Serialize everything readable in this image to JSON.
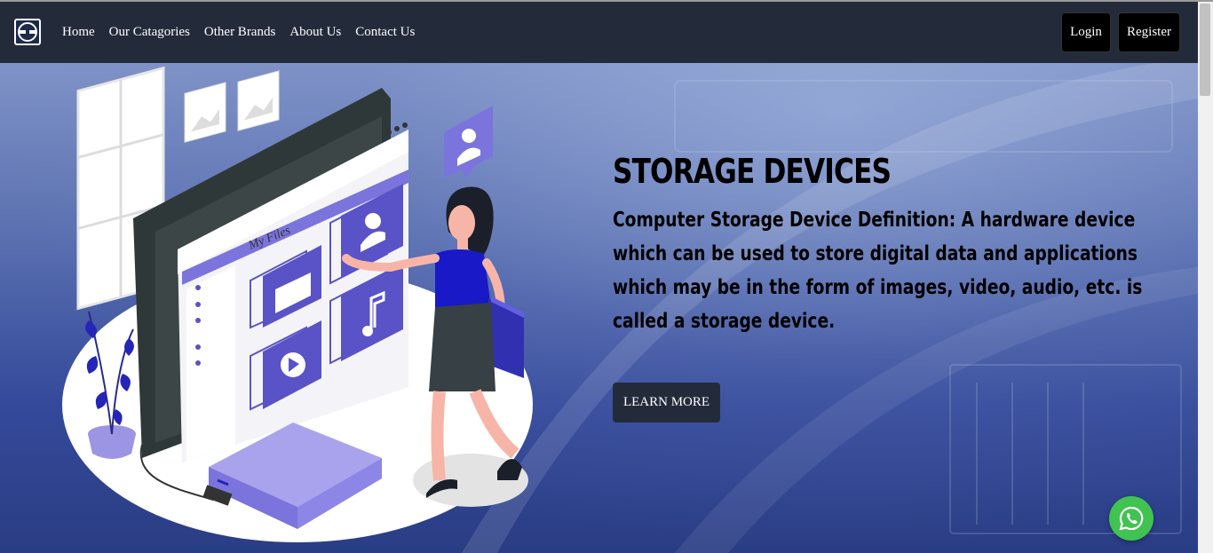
{
  "nav": {
    "links": [
      "Home",
      "Our Catagories",
      "Other Brands",
      "About Us",
      "Contact Us"
    ],
    "login_label": "Login",
    "register_label": "Register"
  },
  "hero": {
    "title": "STORAGE DEVICES",
    "description": "Computer Storage Device Definition: A hardware device which can be used to store digital data and applications which may be in the form of images, video, audio, etc. is called a storage device.",
    "cta_label": "LEARN MORE",
    "illustration": {
      "folder_label": "My Files"
    }
  },
  "icons": {
    "logo": "logo-icon",
    "whatsapp": "whatsapp-icon"
  },
  "colors": {
    "navbar": "#232b3b",
    "button": "#000000",
    "accent": "#5a52c7",
    "whatsapp": "#40c351"
  }
}
